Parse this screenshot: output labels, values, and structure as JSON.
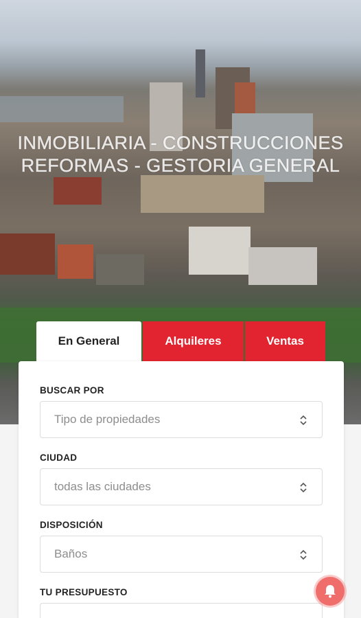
{
  "hero": {
    "line1": "INMOBILIARIA - CONSTRUCCIONES",
    "line2": "REFORMAS - GESTORIA GENERAL"
  },
  "tabs": [
    {
      "label": "En General",
      "active": true
    },
    {
      "label": "Alquileres",
      "active": false
    },
    {
      "label": "Ventas",
      "active": false
    }
  ],
  "form": {
    "fields": [
      {
        "label": "BUSCAR POR",
        "value": "Tipo de propiedades"
      },
      {
        "label": "CIUDAD",
        "value": "todas las ciudades"
      },
      {
        "label": "DISPOSICIÓN",
        "value": "Baños"
      },
      {
        "label": "TU PRESUPUESTO",
        "value": ""
      }
    ]
  },
  "colors": {
    "accent": "#e1242f",
    "notification": "#ef6d6b"
  },
  "icons": {
    "select_indicator": "chevron-up-down-icon",
    "notification": "bell-icon"
  }
}
